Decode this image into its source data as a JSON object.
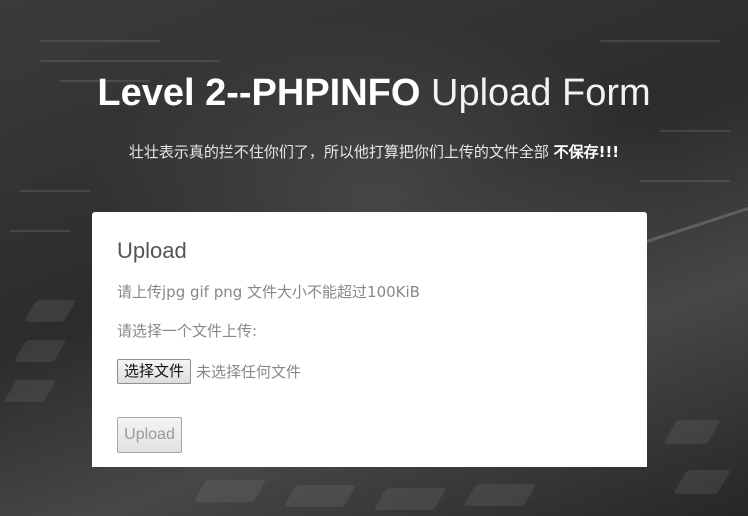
{
  "header": {
    "title_strong": "Level 2--PHPINFO",
    "title_light": "Upload Form",
    "subtitle_main": "壮壮表示真的拦不住你们了，所以他打算把你们上传的文件全部",
    "subtitle_emph": "不保存!!!"
  },
  "upload_panel": {
    "heading": "Upload",
    "hint": "请上传jpg gif png 文件大小不能超过100KiB",
    "choose_label": "请选择一个文件上传:",
    "file_input": {
      "button_label": "选择文件",
      "status": "未选择任何文件"
    },
    "submit_label": "Upload"
  },
  "colors": {
    "background": "#2f2f2f",
    "panel": "#ffffff",
    "title": "#ffffff",
    "muted_text": "#888888"
  }
}
